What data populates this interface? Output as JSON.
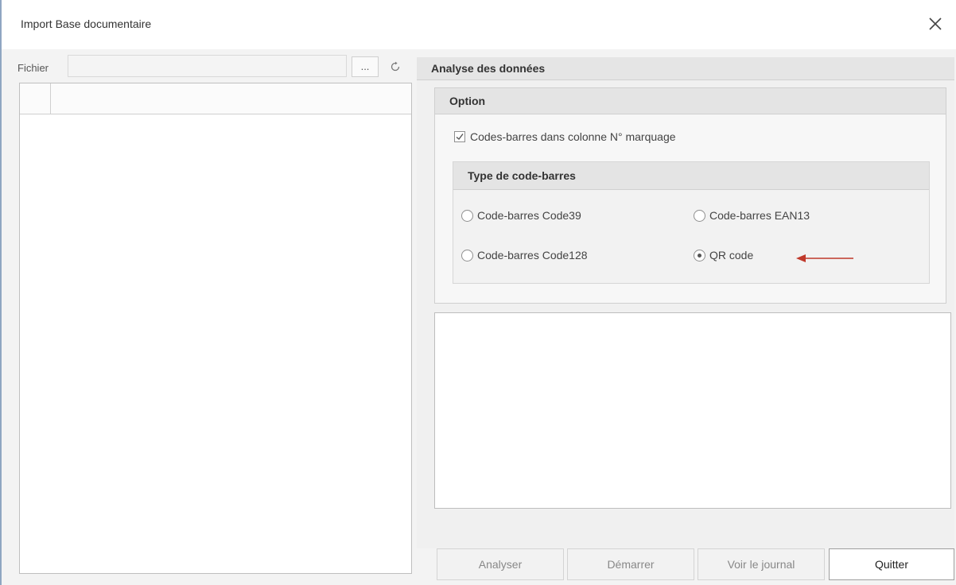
{
  "window": {
    "title": "Import Base documentaire"
  },
  "file": {
    "label": "Fichier",
    "value": "",
    "browse_label": "...",
    "refresh_icon": "refresh-icon"
  },
  "analyse": {
    "title": "Analyse des données",
    "option": {
      "title": "Option",
      "checkbox_label": "Codes-barres dans colonne N° marquage",
      "checkbox_checked": true
    },
    "barcode_type": {
      "title": "Type de code-barres",
      "options": [
        {
          "label": "Code-barres Code39",
          "selected": false
        },
        {
          "label": "Code-barres EAN13",
          "selected": false
        },
        {
          "label": "Code-barres Code128",
          "selected": false
        },
        {
          "label": "QR code",
          "selected": true
        }
      ]
    }
  },
  "buttons": {
    "analyser": "Analyser",
    "demarrer": "Démarrer",
    "voir_journal": "Voir le journal",
    "quitter": "Quitter"
  },
  "colors": {
    "arrow": "#c0392b",
    "window_border": "#8fa6c2"
  }
}
